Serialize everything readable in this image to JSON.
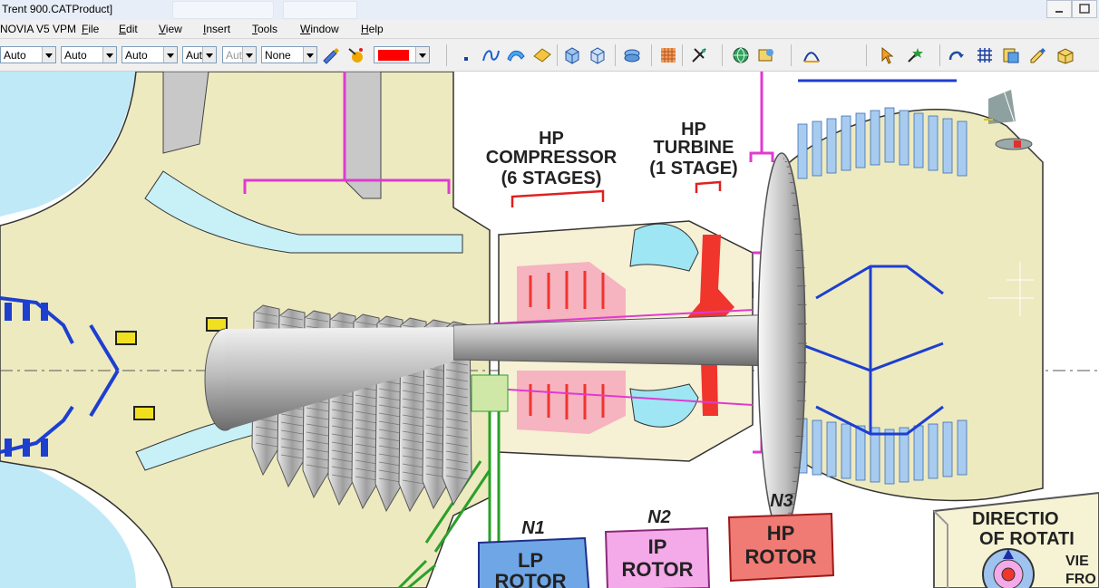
{
  "window": {
    "title": "Trent 900.CATProduct]"
  },
  "menu": {
    "app_label": "NOVIA V5 VPM",
    "items": [
      {
        "label": "File",
        "mnemonic": "F",
        "rest": "ile"
      },
      {
        "label": "Edit",
        "mnemonic": "E",
        "rest": "dit"
      },
      {
        "label": "View",
        "mnemonic": "V",
        "rest": "iew"
      },
      {
        "label": "Insert",
        "mnemonic": "I",
        "rest": "nsert"
      },
      {
        "label": "Tools",
        "mnemonic": "T",
        "rest": "ools"
      },
      {
        "label": "Window",
        "mnemonic": "W",
        "rest": "indow"
      },
      {
        "label": "Help",
        "mnemonic": "H",
        "rest": "elp"
      }
    ]
  },
  "toolbar": {
    "combos": [
      {
        "value": "Auto",
        "disabled": false
      },
      {
        "value": "Auto",
        "disabled": false
      },
      {
        "value": "Auto",
        "disabled": false
      },
      {
        "value": "Aut",
        "disabled": false
      },
      {
        "value": "Aut",
        "disabled": true
      },
      {
        "value": "None",
        "disabled": false
      }
    ],
    "color_swatch": "#ff0000",
    "icons": [
      "painter-icon",
      "highlight-icon",
      "point-icon",
      "spline-icon",
      "surface-icon",
      "plane-icon",
      "cube-icon",
      "cube-alt-icon",
      "assembly-icon",
      "grid-icon",
      "snap-icon",
      "globe-icon",
      "render-icon",
      "curve-icon",
      "select-arrow-icon",
      "star-tool-icon",
      "compass-icon",
      "dot-grid-icon",
      "catalog-icon",
      "edit-icon",
      "package-icon"
    ]
  },
  "diagram": {
    "labels": {
      "hp_compressor_line1": "HP",
      "hp_compressor_line2": "COMPRESSOR",
      "hp_compressor_line3": "(6 STAGES)",
      "hp_turbine_line1": "HP",
      "hp_turbine_line2": "TURBINE",
      "hp_turbine_line3": "(1 STAGE)",
      "n1": "N1",
      "n2": "N2",
      "n3": "N3",
      "lp_rotor_line1": "LP",
      "lp_rotor_line2": "ROTOR",
      "ip_rotor_line1": "IP",
      "ip_rotor_line2": "ROTOR",
      "hp_rotor_line1": "HP",
      "hp_rotor_line2": "ROTOR",
      "direction_line1": "DIRECTIO",
      "direction_line2": "OF ROTATI",
      "view_fragment": "VIE",
      "from_fragment": "FRO"
    },
    "colors": {
      "lp_blue": "#6fa6e6",
      "ip_magenta": "#f4a9e8",
      "hp_red": "#f0352d",
      "casing_beige": "#eeeac0",
      "duct_cyan": "#c7f0f7",
      "sky_blue": "#bfe9f7"
    }
  }
}
